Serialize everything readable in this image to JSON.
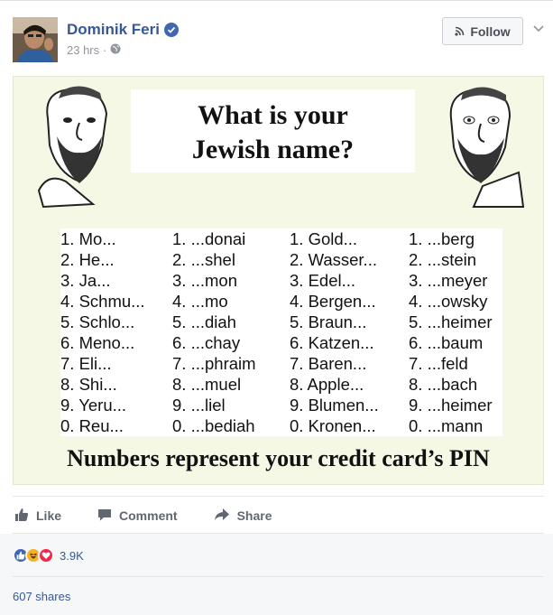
{
  "post": {
    "author": "Dominik Feri",
    "time": "23 hrs",
    "separator": "·",
    "follow_label": "Follow",
    "image": {
      "title_line1": "What is your",
      "title_line2": "Jewish name?",
      "columns": [
        [
          "1. Mo...",
          "2. He...",
          "3. Ja...",
          "4. Schmu...",
          "5. Schlo...",
          "6. Meno...",
          "7. Eli...",
          "8. Shi...",
          "9. Yeru...",
          "0. Reu..."
        ],
        [
          "1. ...donai",
          "2. ...shel",
          "3. ...mon",
          "4. ...mo",
          "5. ...diah",
          "6. ...chay",
          "7. ...phraim",
          "8. ...muel",
          "9. ...liel",
          "0. ...bediah"
        ],
        [
          "1. Gold...",
          "2. Wasser...",
          "3. Edel...",
          "4. Bergen...",
          "5. Braun...",
          "6. Katzen...",
          "7. Baren...",
          "8. Apple...",
          "9. Blumen...",
          "0. Kronen..."
        ],
        [
          "1. ...berg",
          "2. ...stein",
          "3. ...meyer",
          "4. ...owsky",
          "5. ...heimer",
          "6. ...baum",
          "7. ...feld",
          "8. ...bach",
          "9. ...heimer",
          "0. ...mann"
        ]
      ],
      "footer": "Numbers represent your credit card’s PIN"
    }
  },
  "actions": {
    "like": "Like",
    "comment": "Comment",
    "share": "Share"
  },
  "stats": {
    "reaction_count": "3.9K",
    "shares": "607 shares"
  },
  "colors": {
    "link": "#365899",
    "like_blue": "#4267b2",
    "love_red": "#f0284a",
    "haha_yellow": "#f7b125"
  },
  "icons": {
    "verified": "check-badge-icon",
    "globe": "globe-icon",
    "follow": "rss-icon"
  }
}
